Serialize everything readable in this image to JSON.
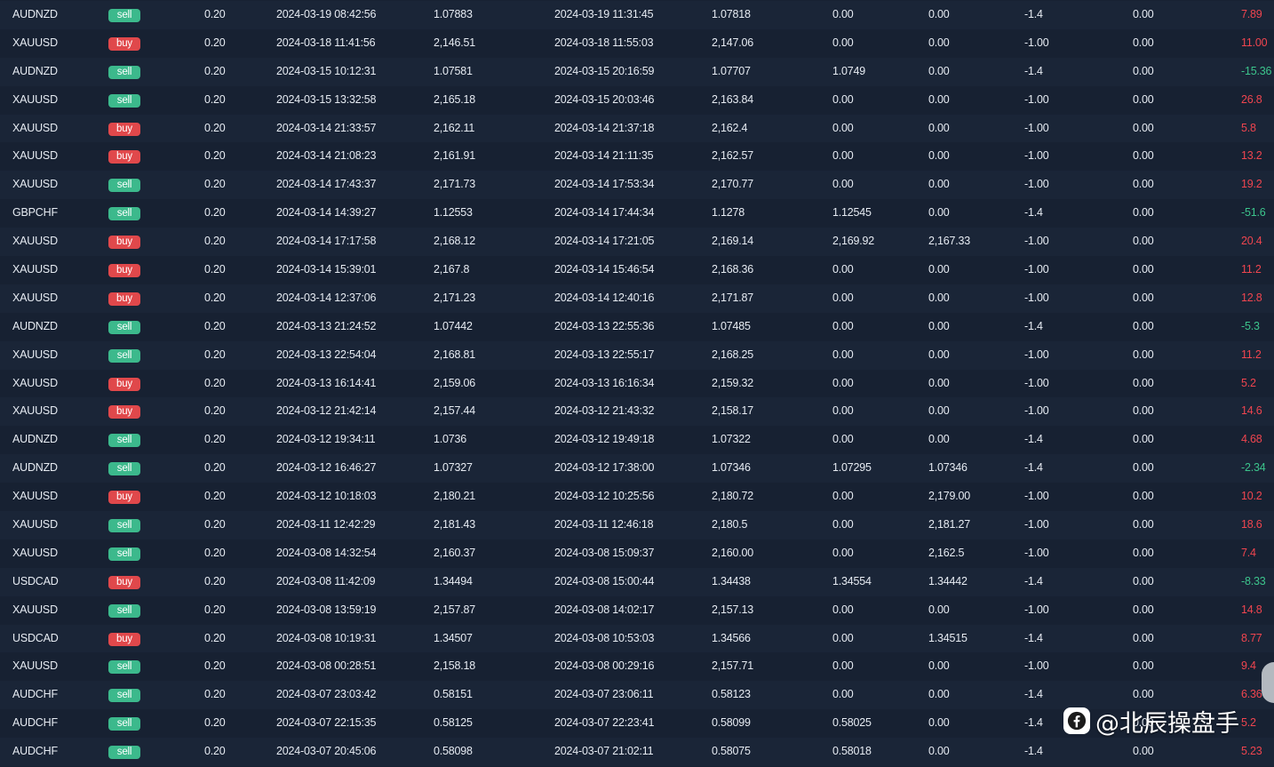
{
  "rows": [
    {
      "symbol": "AUDNZD",
      "side": "sell",
      "lot": "0.20",
      "open_time": "2024-03-19 08:42:56",
      "open_price": "1.07883",
      "close_time": "2024-03-19 11:31:45",
      "close_price": "1.07818",
      "sl": "0.00",
      "tp": "0.00",
      "swap": "-1.4",
      "commission": "0.00",
      "profit": "7.89",
      "profit_dir": "pos"
    },
    {
      "symbol": "XAUUSD",
      "side": "buy",
      "lot": "0.20",
      "open_time": "2024-03-18 11:41:56",
      "open_price": "2,146.51",
      "close_time": "2024-03-18 11:55:03",
      "close_price": "2,147.06",
      "sl": "0.00",
      "tp": "0.00",
      "swap": "-1.00",
      "commission": "0.00",
      "profit": "11.00",
      "profit_dir": "pos"
    },
    {
      "symbol": "AUDNZD",
      "side": "sell",
      "lot": "0.20",
      "open_time": "2024-03-15 10:12:31",
      "open_price": "1.07581",
      "close_time": "2024-03-15 20:16:59",
      "close_price": "1.07707",
      "sl": "1.0749",
      "tp": "0.00",
      "swap": "-1.4",
      "commission": "0.00",
      "profit": "-15.36",
      "profit_dir": "neg"
    },
    {
      "symbol": "XAUUSD",
      "side": "sell",
      "lot": "0.20",
      "open_time": "2024-03-15 13:32:58",
      "open_price": "2,165.18",
      "close_time": "2024-03-15 20:03:46",
      "close_price": "2,163.84",
      "sl": "0.00",
      "tp": "0.00",
      "swap": "-1.00",
      "commission": "0.00",
      "profit": "26.8",
      "profit_dir": "pos"
    },
    {
      "symbol": "XAUUSD",
      "side": "buy",
      "lot": "0.20",
      "open_time": "2024-03-14 21:33:57",
      "open_price": "2,162.11",
      "close_time": "2024-03-14 21:37:18",
      "close_price": "2,162.4",
      "sl": "0.00",
      "tp": "0.00",
      "swap": "-1.00",
      "commission": "0.00",
      "profit": "5.8",
      "profit_dir": "pos"
    },
    {
      "symbol": "XAUUSD",
      "side": "buy",
      "lot": "0.20",
      "open_time": "2024-03-14 21:08:23",
      "open_price": "2,161.91",
      "close_time": "2024-03-14 21:11:35",
      "close_price": "2,162.57",
      "sl": "0.00",
      "tp": "0.00",
      "swap": "-1.00",
      "commission": "0.00",
      "profit": "13.2",
      "profit_dir": "pos"
    },
    {
      "symbol": "XAUUSD",
      "side": "sell",
      "lot": "0.20",
      "open_time": "2024-03-14 17:43:37",
      "open_price": "2,171.73",
      "close_time": "2024-03-14 17:53:34",
      "close_price": "2,170.77",
      "sl": "0.00",
      "tp": "0.00",
      "swap": "-1.00",
      "commission": "0.00",
      "profit": "19.2",
      "profit_dir": "pos"
    },
    {
      "symbol": "GBPCHF",
      "side": "sell",
      "lot": "0.20",
      "open_time": "2024-03-14 14:39:27",
      "open_price": "1.12553",
      "close_time": "2024-03-14 17:44:34",
      "close_price": "1.1278",
      "sl": "1.12545",
      "tp": "0.00",
      "swap": "-1.4",
      "commission": "0.00",
      "profit": "-51.6",
      "profit_dir": "neg"
    },
    {
      "symbol": "XAUUSD",
      "side": "buy",
      "lot": "0.20",
      "open_time": "2024-03-14 17:17:58",
      "open_price": "2,168.12",
      "close_time": "2024-03-14 17:21:05",
      "close_price": "2,169.14",
      "sl": "2,169.92",
      "tp": "2,167.33",
      "swap": "-1.00",
      "commission": "0.00",
      "profit": "20.4",
      "profit_dir": "pos"
    },
    {
      "symbol": "XAUUSD",
      "side": "buy",
      "lot": "0.20",
      "open_time": "2024-03-14 15:39:01",
      "open_price": "2,167.8",
      "close_time": "2024-03-14 15:46:54",
      "close_price": "2,168.36",
      "sl": "0.00",
      "tp": "0.00",
      "swap": "-1.00",
      "commission": "0.00",
      "profit": "11.2",
      "profit_dir": "pos"
    },
    {
      "symbol": "XAUUSD",
      "side": "buy",
      "lot": "0.20",
      "open_time": "2024-03-14 12:37:06",
      "open_price": "2,171.23",
      "close_time": "2024-03-14 12:40:16",
      "close_price": "2,171.87",
      "sl": "0.00",
      "tp": "0.00",
      "swap": "-1.00",
      "commission": "0.00",
      "profit": "12.8",
      "profit_dir": "pos"
    },
    {
      "symbol": "AUDNZD",
      "side": "sell",
      "lot": "0.20",
      "open_time": "2024-03-13 21:24:52",
      "open_price": "1.07442",
      "close_time": "2024-03-13 22:55:36",
      "close_price": "1.07485",
      "sl": "0.00",
      "tp": "0.00",
      "swap": "-1.4",
      "commission": "0.00",
      "profit": "-5.3",
      "profit_dir": "neg"
    },
    {
      "symbol": "XAUUSD",
      "side": "sell",
      "lot": "0.20",
      "open_time": "2024-03-13 22:54:04",
      "open_price": "2,168.81",
      "close_time": "2024-03-13 22:55:17",
      "close_price": "2,168.25",
      "sl": "0.00",
      "tp": "0.00",
      "swap": "-1.00",
      "commission": "0.00",
      "profit": "11.2",
      "profit_dir": "pos"
    },
    {
      "symbol": "XAUUSD",
      "side": "buy",
      "lot": "0.20",
      "open_time": "2024-03-13 16:14:41",
      "open_price": "2,159.06",
      "close_time": "2024-03-13 16:16:34",
      "close_price": "2,159.32",
      "sl": "0.00",
      "tp": "0.00",
      "swap": "-1.00",
      "commission": "0.00",
      "profit": "5.2",
      "profit_dir": "pos"
    },
    {
      "symbol": "XAUUSD",
      "side": "buy",
      "lot": "0.20",
      "open_time": "2024-03-12 21:42:14",
      "open_price": "2,157.44",
      "close_time": "2024-03-12 21:43:32",
      "close_price": "2,158.17",
      "sl": "0.00",
      "tp": "0.00",
      "swap": "-1.00",
      "commission": "0.00",
      "profit": "14.6",
      "profit_dir": "pos"
    },
    {
      "symbol": "AUDNZD",
      "side": "sell",
      "lot": "0.20",
      "open_time": "2024-03-12 19:34:11",
      "open_price": "1.0736",
      "close_time": "2024-03-12 19:49:18",
      "close_price": "1.07322",
      "sl": "0.00",
      "tp": "0.00",
      "swap": "-1.4",
      "commission": "0.00",
      "profit": "4.68",
      "profit_dir": "pos"
    },
    {
      "symbol": "AUDNZD",
      "side": "sell",
      "lot": "0.20",
      "open_time": "2024-03-12 16:46:27",
      "open_price": "1.07327",
      "close_time": "2024-03-12 17:38:00",
      "close_price": "1.07346",
      "sl": "1.07295",
      "tp": "1.07346",
      "swap": "-1.4",
      "commission": "0.00",
      "profit": "-2.34",
      "profit_dir": "neg"
    },
    {
      "symbol": "XAUUSD",
      "side": "buy",
      "lot": "0.20",
      "open_time": "2024-03-12 10:18:03",
      "open_price": "2,180.21",
      "close_time": "2024-03-12 10:25:56",
      "close_price": "2,180.72",
      "sl": "0.00",
      "tp": "2,179.00",
      "swap": "-1.00",
      "commission": "0.00",
      "profit": "10.2",
      "profit_dir": "pos"
    },
    {
      "symbol": "XAUUSD",
      "side": "sell",
      "lot": "0.20",
      "open_time": "2024-03-11 12:42:29",
      "open_price": "2,181.43",
      "close_time": "2024-03-11 12:46:18",
      "close_price": "2,180.5",
      "sl": "0.00",
      "tp": "2,181.27",
      "swap": "-1.00",
      "commission": "0.00",
      "profit": "18.6",
      "profit_dir": "pos"
    },
    {
      "symbol": "XAUUSD",
      "side": "sell",
      "lot": "0.20",
      "open_time": "2024-03-08 14:32:54",
      "open_price": "2,160.37",
      "close_time": "2024-03-08 15:09:37",
      "close_price": "2,160.00",
      "sl": "0.00",
      "tp": "2,162.5",
      "swap": "-1.00",
      "commission": "0.00",
      "profit": "7.4",
      "profit_dir": "pos"
    },
    {
      "symbol": "USDCAD",
      "side": "buy",
      "lot": "0.20",
      "open_time": "2024-03-08 11:42:09",
      "open_price": "1.34494",
      "close_time": "2024-03-08 15:00:44",
      "close_price": "1.34438",
      "sl": "1.34554",
      "tp": "1.34442",
      "swap": "-1.4",
      "commission": "0.00",
      "profit": "-8.33",
      "profit_dir": "neg"
    },
    {
      "symbol": "XAUUSD",
      "side": "sell",
      "lot": "0.20",
      "open_time": "2024-03-08 13:59:19",
      "open_price": "2,157.87",
      "close_time": "2024-03-08 14:02:17",
      "close_price": "2,157.13",
      "sl": "0.00",
      "tp": "0.00",
      "swap": "-1.00",
      "commission": "0.00",
      "profit": "14.8",
      "profit_dir": "pos"
    },
    {
      "symbol": "USDCAD",
      "side": "buy",
      "lot": "0.20",
      "open_time": "2024-03-08 10:19:31",
      "open_price": "1.34507",
      "close_time": "2024-03-08 10:53:03",
      "close_price": "1.34566",
      "sl": "0.00",
      "tp": "1.34515",
      "swap": "-1.4",
      "commission": "0.00",
      "profit": "8.77",
      "profit_dir": "pos"
    },
    {
      "symbol": "XAUUSD",
      "side": "sell",
      "lot": "0.20",
      "open_time": "2024-03-08 00:28:51",
      "open_price": "2,158.18",
      "close_time": "2024-03-08 00:29:16",
      "close_price": "2,157.71",
      "sl": "0.00",
      "tp": "0.00",
      "swap": "-1.00",
      "commission": "0.00",
      "profit": "9.4",
      "profit_dir": "pos"
    },
    {
      "symbol": "AUDCHF",
      "side": "sell",
      "lot": "0.20",
      "open_time": "2024-03-07 23:03:42",
      "open_price": "0.58151",
      "close_time": "2024-03-07 23:06:11",
      "close_price": "0.58123",
      "sl": "0.00",
      "tp": "0.00",
      "swap": "-1.4",
      "commission": "0.00",
      "profit": "6.36",
      "profit_dir": "pos"
    },
    {
      "symbol": "AUDCHF",
      "side": "sell",
      "lot": "0.20",
      "open_time": "2024-03-07 22:15:35",
      "open_price": "0.58125",
      "close_time": "2024-03-07 22:23:41",
      "close_price": "0.58099",
      "sl": "0.58025",
      "tp": "0.00",
      "swap": "-1.4",
      "commission": "0.00",
      "profit": "5.2",
      "profit_dir": "pos"
    },
    {
      "symbol": "AUDCHF",
      "side": "sell",
      "lot": "0.20",
      "open_time": "2024-03-07 20:45:06",
      "open_price": "0.58098",
      "close_time": "2024-03-07 21:02:11",
      "close_price": "0.58075",
      "sl": "0.58018",
      "tp": "0.00",
      "swap": "-1.4",
      "commission": "0.00",
      "profit": "5.23",
      "profit_dir": "pos"
    }
  ],
  "colors": {
    "background": "#182233",
    "profit_positive": "#f0454f",
    "profit_negative": "#3cc48c",
    "buy_badge": "#e0484b",
    "sell_badge": "#3cb98c"
  },
  "watermark": {
    "icon": "facebook-icon",
    "text": "@北辰操盘手"
  }
}
